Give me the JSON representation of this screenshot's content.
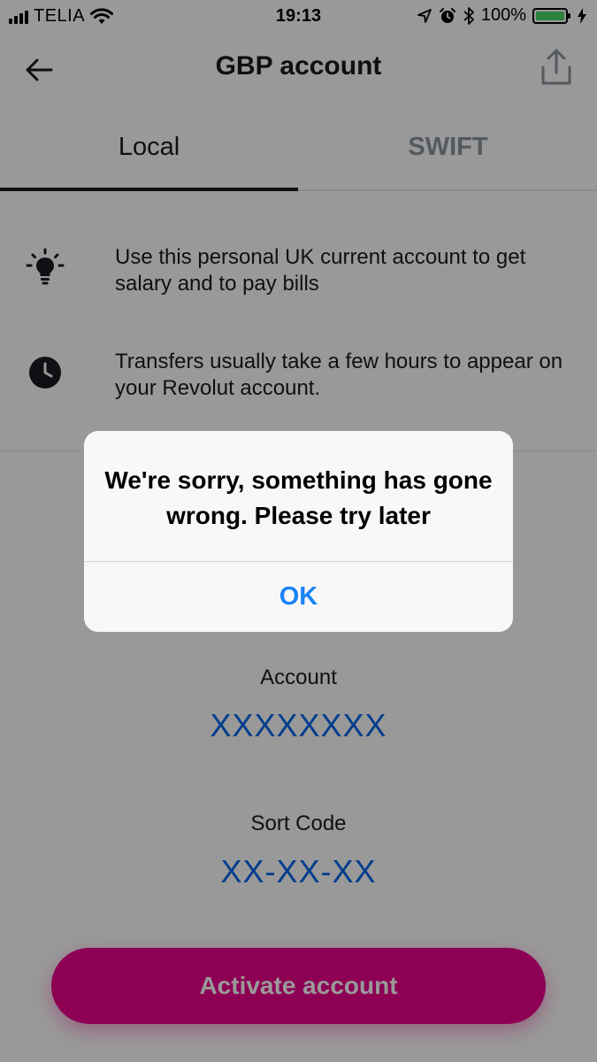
{
  "status_bar": {
    "carrier": "TELIA",
    "time": "19:13",
    "battery_percent": "100%",
    "battery_level": 1.0,
    "battery_color": "#4cd964",
    "icons": [
      "signal-icon",
      "wifi-icon",
      "location-arrow-icon",
      "alarm-icon",
      "bluetooth-icon",
      "battery-icon",
      "charging-icon"
    ]
  },
  "header": {
    "title": "GBP account",
    "back_icon": "arrow-left-icon",
    "share_icon": "share-icon"
  },
  "tabs": [
    {
      "label": "Local",
      "selected": true
    },
    {
      "label": "SWIFT",
      "selected": false
    }
  ],
  "info": [
    {
      "icon": "lightbulb-icon",
      "text": "Use this personal UK current account to get salary and to pay bills"
    },
    {
      "icon": "clock-icon",
      "text": "Transfers usually take a few hours to appear on your Revolut account."
    }
  ],
  "account": {
    "account_label": "Account",
    "account_value": "XXXXXXXX",
    "sort_code_label": "Sort Code",
    "sort_code_value": "XX-XX-XX"
  },
  "activate_button": "Activate account",
  "alert": {
    "message": "We're sorry, something has gone wrong. Please try later",
    "ok": "OK"
  },
  "colors": {
    "accent_pink": "#eb008d",
    "link_blue": "#0666eb",
    "ios_blue": "#1a82f7"
  }
}
